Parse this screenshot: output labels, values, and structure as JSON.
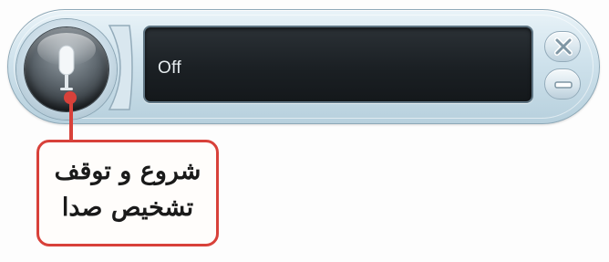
{
  "widget": {
    "status_text": "Off",
    "mic_button": {
      "icon": "microphone-icon"
    },
    "close_button": {
      "icon": "close-icon"
    },
    "minimize_button": {
      "icon": "minimize-icon"
    }
  },
  "callout": {
    "line1": "شروع و توقف",
    "line2": "تشخیص صدا"
  },
  "colors": {
    "callout_border": "#d8413a",
    "display_background": "#1b2024",
    "widget_frame": "#cfe2ec"
  }
}
